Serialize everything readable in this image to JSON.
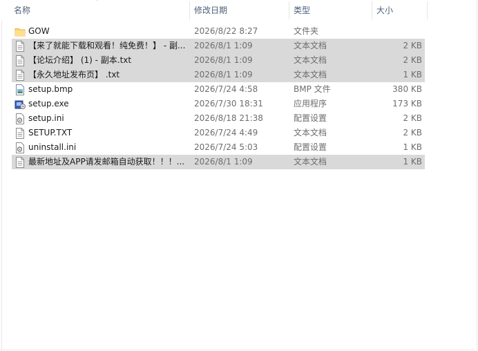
{
  "columns": {
    "name": "名称",
    "modified": "修改日期",
    "type": "类型",
    "size": "大小"
  },
  "files": [
    {
      "icon": "folder-icon",
      "name": "GOW",
      "modified": "2026/8/22 8:27",
      "type": "文件夹",
      "size": "",
      "selected": false
    },
    {
      "icon": "text-file-icon",
      "name": "【来了就能下载和观看！纯免费！】 - 副...",
      "modified": "2026/8/1 1:09",
      "type": "文本文档",
      "size": "2 KB",
      "selected": true
    },
    {
      "icon": "text-file-icon",
      "name": "【论坛介绍】 (1) - 副本.txt",
      "modified": "2026/8/1 1:09",
      "type": "文本文档",
      "size": "2 KB",
      "selected": true
    },
    {
      "icon": "text-file-icon",
      "name": "【永久地址发布页】 .txt",
      "modified": "2026/8/1 1:09",
      "type": "文本文档",
      "size": "1 KB",
      "selected": true
    },
    {
      "icon": "image-file-icon",
      "name": "setup.bmp",
      "modified": "2026/7/24 4:58",
      "type": "BMP 文件",
      "size": "380 KB",
      "selected": false
    },
    {
      "icon": "installer-icon",
      "name": "setup.exe",
      "modified": "2026/7/30 18:31",
      "type": "应用程序",
      "size": "173 KB",
      "selected": false
    },
    {
      "icon": "settings-file-icon",
      "name": "setup.ini",
      "modified": "2026/8/18 21:38",
      "type": "配置设置",
      "size": "2 KB",
      "selected": false
    },
    {
      "icon": "text-file-icon",
      "name": "SETUP.TXT",
      "modified": "2026/7/24 4:49",
      "type": "文本文档",
      "size": "2 KB",
      "selected": false
    },
    {
      "icon": "settings-file-icon",
      "name": "uninstall.ini",
      "modified": "2026/7/24 5:03",
      "type": "配置设置",
      "size": "1 KB",
      "selected": false
    },
    {
      "icon": "text-file-icon",
      "name": "最新地址及APP请发邮箱自动获取！！！...",
      "modified": "2026/8/1 1:09",
      "type": "文本文档",
      "size": "1 KB",
      "selected": true
    }
  ]
}
